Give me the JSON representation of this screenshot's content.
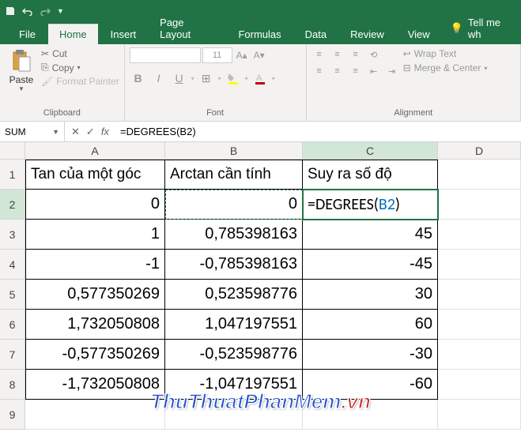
{
  "qat": {
    "save": "save",
    "undo": "undo",
    "redo": "redo"
  },
  "tabs": {
    "file": "File",
    "home": "Home",
    "insert": "Insert",
    "pagelayout": "Page Layout",
    "formulas": "Formulas",
    "data": "Data",
    "review": "Review",
    "view": "View",
    "tellme": "Tell me wh"
  },
  "ribbon": {
    "clipboard": {
      "paste": "Paste",
      "cut": "Cut",
      "copy": "Copy",
      "painter": "Format Painter",
      "label": "Clipboard"
    },
    "font": {
      "size": "11",
      "label": "Font"
    },
    "alignment": {
      "wrap": "Wrap Text",
      "merge": "Merge & Center",
      "label": "Alignment"
    }
  },
  "namebox": "SUM",
  "formulabar": "=DEGREES(B2)",
  "columns": {
    "A": "A",
    "B": "B",
    "C": "C",
    "D": "D"
  },
  "rows": [
    "1",
    "2",
    "3",
    "4",
    "5",
    "6",
    "7",
    "8",
    "9"
  ],
  "headers": {
    "A": "Tan của một góc",
    "B": "Arctan cần tính",
    "C": "Suy ra số độ"
  },
  "active_cell_formula": {
    "prefix": "=DEGREES(",
    "ref": "B2",
    "suffix": ")"
  },
  "chart_data": {
    "type": "table",
    "columns": [
      "Tan của một góc",
      "Arctan cần tính",
      "Suy ra số độ"
    ],
    "rows": [
      {
        "A": "0",
        "B": "0",
        "C": "=DEGREES(B2)"
      },
      {
        "A": "1",
        "B": "0,785398163",
        "C": "45"
      },
      {
        "A": "-1",
        "B": "-0,785398163",
        "C": "-45"
      },
      {
        "A": "0,577350269",
        "B": "0,523598776",
        "C": "30"
      },
      {
        "A": "1,732050808",
        "B": "1,047197551",
        "C": "60"
      },
      {
        "A": "-0,577350269",
        "B": "-0,523598776",
        "C": "-30"
      },
      {
        "A": "-1,732050808",
        "B": "-1,047197551",
        "C": "-60"
      }
    ]
  },
  "watermark": {
    "part1": "ThuThuatPhanMem",
    "part2": ".vn"
  }
}
